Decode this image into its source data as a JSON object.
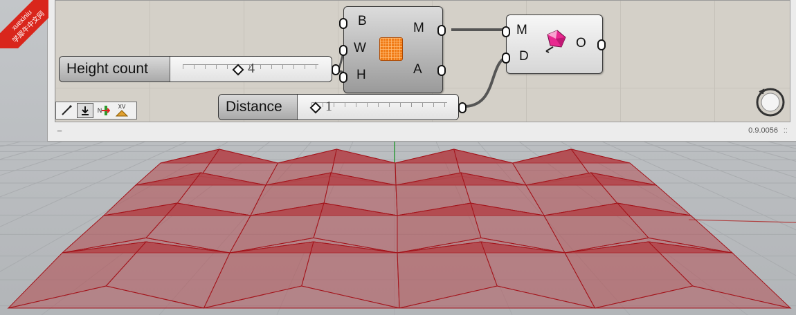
{
  "watermark": {
    "line1": "xuexiniu",
    "line2": "学犀牛中文网"
  },
  "status": {
    "left_text": "_",
    "version": "0.9.0056",
    "resize_grip": "::"
  },
  "components": {
    "panel_component": {
      "inputs": [
        "B",
        "W",
        "H"
      ],
      "outputs": [
        "M",
        "A"
      ],
      "icon": "orange-grid-panel-icon"
    },
    "offset_component": {
      "inputs": [
        "M",
        "D"
      ],
      "outputs": [
        "O"
      ],
      "icon": "pink-gem-offset-icon"
    }
  },
  "sliders": {
    "height_count": {
      "label": "Height count",
      "value": "4"
    },
    "distance": {
      "label": "Distance",
      "value": "1"
    }
  },
  "toolbar": {
    "tools": [
      "pencil-icon",
      "download-icon",
      "n-arrow-icon",
      "xv-icon"
    ],
    "n_label": "N",
    "xv_label": "XV"
  },
  "colors": {
    "canvas": "#d4d0c8",
    "mesh_fill": "#b3484d",
    "mesh_edge": "#a3141b",
    "viewport_bg": "#b9bcbf"
  }
}
